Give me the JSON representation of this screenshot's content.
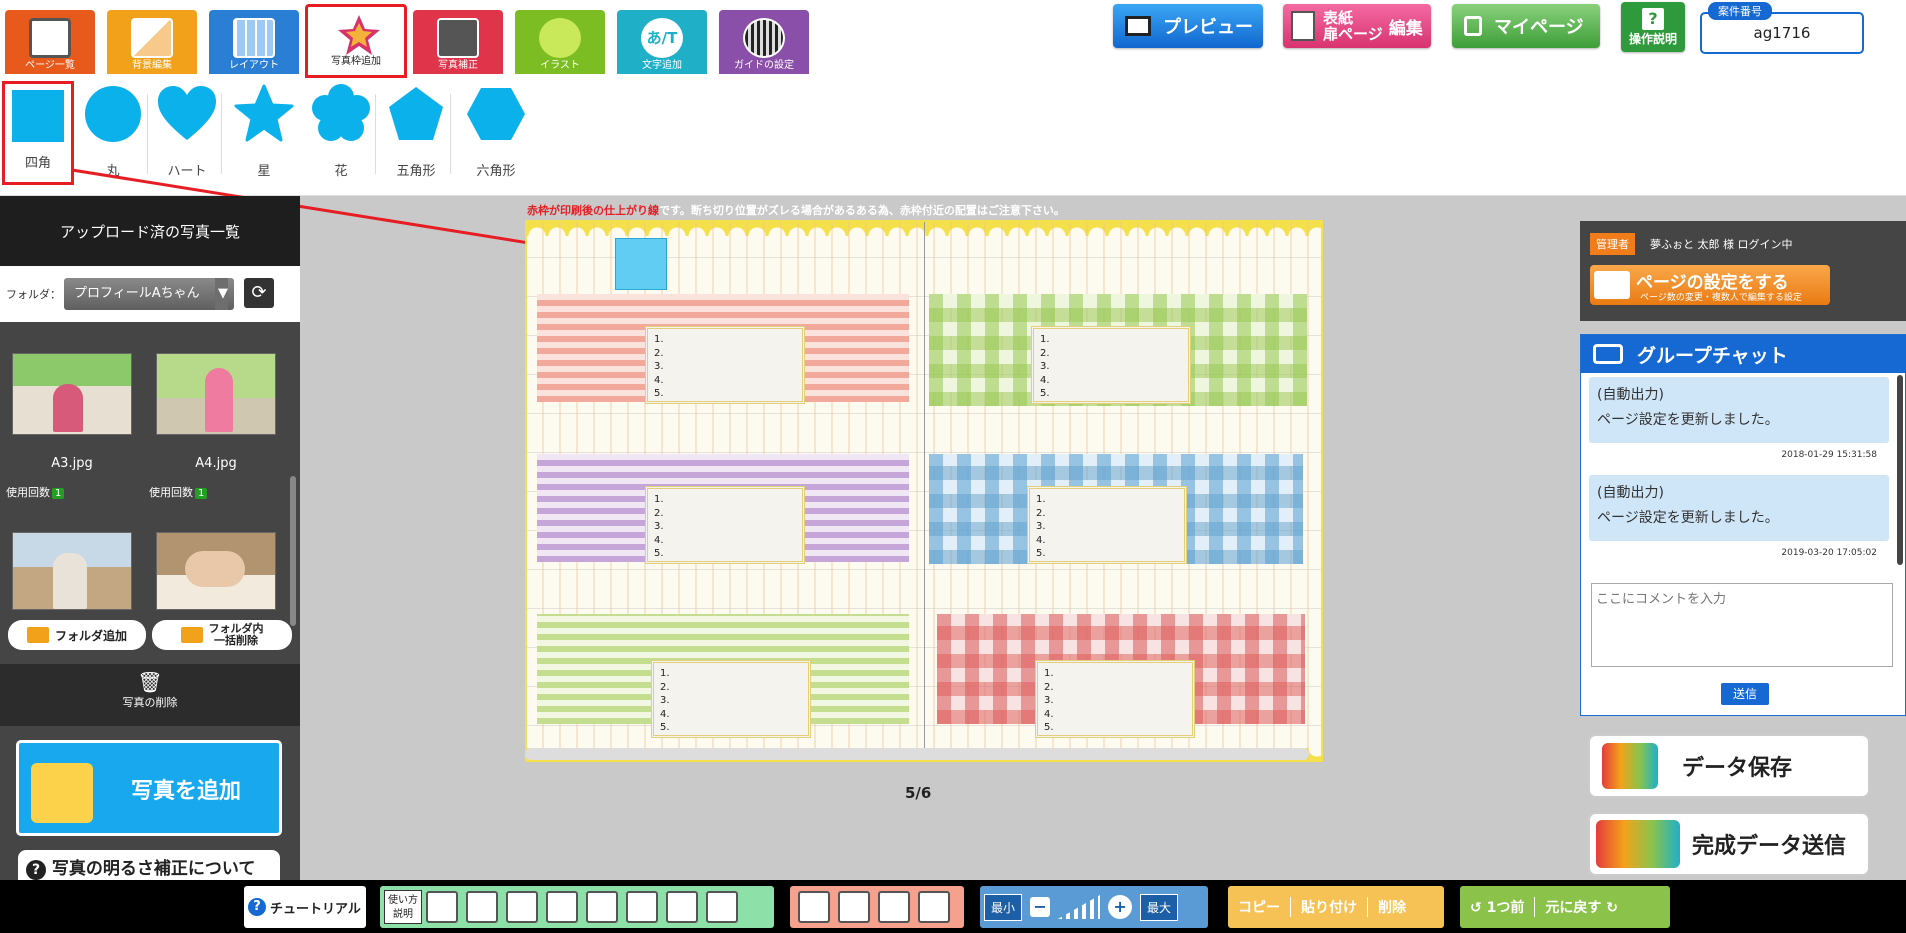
{
  "toolbar": {
    "tools": [
      {
        "label": "ページ一覧",
        "color": "#e85a1c"
      },
      {
        "label": "背景編集",
        "color": "#f2a21a"
      },
      {
        "label": "レイアウト",
        "color": "#2a7fd4"
      },
      {
        "label": "写真枠追加",
        "color": "#ffffff"
      },
      {
        "label": "写真補正",
        "color": "#e0344b"
      },
      {
        "label": "イラスト",
        "color": "#7bbd22"
      },
      {
        "label": "文字追加",
        "color": "#1fb0c8"
      },
      {
        "label": "ガイドの設定",
        "color": "#8a4fa8"
      }
    ],
    "preview_label": "プレビュー",
    "cover_label_line1": "表紙",
    "cover_label_line2": "扉ページ",
    "cover_edit_label": "編集",
    "mypage_label": "マイページ",
    "help_label": "操作説明",
    "case_number_label": "案件番号",
    "case_number_value": "ag1716"
  },
  "shapes": {
    "items": [
      {
        "label": "四角",
        "icon": "square-icon"
      },
      {
        "label": "丸",
        "icon": "circle-icon"
      },
      {
        "label": "ハート",
        "icon": "heart-icon"
      },
      {
        "label": "星",
        "icon": "star-icon"
      },
      {
        "label": "花",
        "icon": "flower-icon"
      },
      {
        "label": "五角形",
        "icon": "pentagon-icon"
      },
      {
        "label": "六角形",
        "icon": "hexagon-icon"
      }
    ],
    "shape_color": "#0bb1ea"
  },
  "left_panel": {
    "title": "アップロード済の写真一覧",
    "folder_label": "フォルダ：",
    "folder_value": "プロフィールAちゃん",
    "photos": [
      {
        "name": "A3.jpg",
        "usage_label": "使用回数",
        "usage_count": "1"
      },
      {
        "name": "A4.jpg",
        "usage_label": "使用回数",
        "usage_count": "1"
      }
    ],
    "add_folder_label": "フォルダ追加",
    "delete_in_folder_line1": "フォルダ内",
    "delete_in_folder_line2": "一括削除",
    "delete_photo_label": "写真の削除",
    "add_photo_label": "写真を追加",
    "brightness_label": "写真の明るさ補正について"
  },
  "canvas": {
    "warning_red": "赤枠が印刷後の仕上がり線",
    "warning_rest": "です。断ち切り位置がズレる場合があるある為、赤枠付近の配置はご注意下さい。",
    "note_lines": [
      "1.",
      "2.",
      "3.",
      "4.",
      "5."
    ],
    "page_indicator": "5/6"
  },
  "right_panel": {
    "admin_badge": "管理者",
    "login_text": "夢ふぉと 太郎 様 ログイン中",
    "page_settings_label": "ページの設定をする",
    "page_settings_sub": "ページ数の変更・複数人で編集する設定",
    "chat_title": "グループチャット",
    "messages": [
      {
        "line1": "(自動出力)",
        "line2": "ページ設定を更新しました。",
        "timestamp": "2018-01-29 15:31:58"
      },
      {
        "line1": "(自動出力)",
        "line2": "ページ設定を更新しました。",
        "timestamp": "2019-03-20 17:05:02"
      }
    ],
    "comment_placeholder": "ここにコメントを入力",
    "send_label": "送信",
    "save_label": "データ保存",
    "send_complete_label": "完成データ送信"
  },
  "bottom_bar": {
    "tutorial_label": "チュートリアル",
    "howto_line1": "使い方",
    "howto_line2": "説明",
    "zoom_min_label": "最小",
    "zoom_max_label": "最大",
    "copy_label": "コピー",
    "paste_label": "貼り付け",
    "delete_label": "削除",
    "undo_label": "1つ前",
    "redo_label": "元に戻す"
  }
}
